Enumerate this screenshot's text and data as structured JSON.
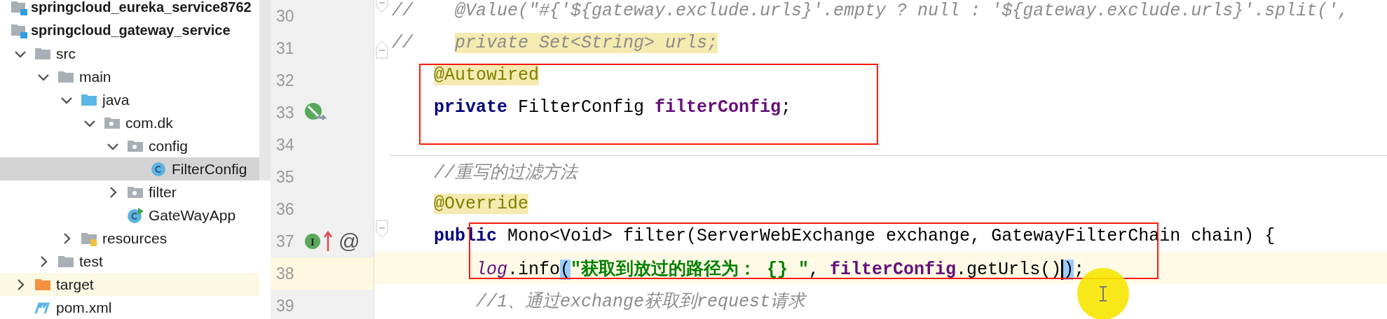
{
  "project_tree": {
    "items": [
      {
        "kind": "module",
        "label": "springcloud_eureka_service8762"
      },
      {
        "kind": "module",
        "label": "springcloud_gateway_service",
        "children": [
          {
            "kind": "folder",
            "label": "src",
            "expanded": true,
            "children": [
              {
                "kind": "folder",
                "label": "main",
                "expanded": true,
                "children": [
                  {
                    "kind": "source-root",
                    "label": "java",
                    "expanded": true,
                    "children": [
                      {
                        "kind": "package",
                        "label": "com.dk",
                        "expanded": true,
                        "children": [
                          {
                            "kind": "package",
                            "label": "config",
                            "expanded": true,
                            "children": [
                              {
                                "kind": "class",
                                "label": "FilterConfig",
                                "selected": true
                              }
                            ]
                          },
                          {
                            "kind": "package",
                            "label": "filter",
                            "expanded": false,
                            "selected": false
                          },
                          {
                            "kind": "app-class",
                            "label": "GateWayApp",
                            "selected": false
                          }
                        ]
                      }
                    ]
                  },
                  {
                    "kind": "resources",
                    "label": "resources",
                    "expanded": false,
                    "selected": false
                  }
                ]
              },
              {
                "kind": "folder",
                "label": "test",
                "expanded": false,
                "selected": false
              }
            ]
          },
          {
            "kind": "excluded",
            "label": "target",
            "expanded": false,
            "selected": false,
            "ignored": true
          },
          {
            "kind": "maven",
            "label": "pom.xml",
            "selected": false
          }
        ]
      }
    ]
  },
  "editor": {
    "lines": [
      {
        "number": "30",
        "kind": "top",
        "fold_start": true,
        "tokens": [
          {
            "kind": "comment",
            "text": "//    @Value(\"#{'${gateway.exclude.urls}'.empty ? null : '${gateway.exclude.urls}'.split(',"
          }
        ]
      },
      {
        "number": "31",
        "kind": "top",
        "fold_end": true,
        "tokens": [
          {
            "kind": "comment",
            "text": "//    "
          },
          {
            "kind": "comment",
            "text": "private Set<String> urls;",
            "marked": true
          }
        ]
      },
      {
        "number": "32",
        "kind": "member",
        "tokens": [
          {
            "kind": "annotation",
            "text": "@Autowired",
            "marked": true
          }
        ]
      },
      {
        "number": "33",
        "kind": "member",
        "gutter": [
          {
            "kind": "bean"
          }
        ],
        "tokens": [
          {
            "kind": "keyword",
            "text": "private"
          },
          {
            "kind": "plain",
            "text": " FilterConfig "
          },
          {
            "kind": "field",
            "text": "filterConfig"
          },
          {
            "kind": "plain",
            "text": ";"
          }
        ]
      },
      {
        "number": "34",
        "kind": "top"
      },
      {
        "number": "35",
        "kind": "member",
        "separator_above": true,
        "tokens": [
          {
            "kind": "comment",
            "text": "//重写的过滤方法"
          }
        ]
      },
      {
        "number": "36",
        "kind": "member",
        "tokens": [
          {
            "kind": "annotation",
            "text": "@Override",
            "marked": true
          }
        ]
      },
      {
        "number": "37",
        "kind": "member",
        "fold_start": true,
        "gutter": [
          {
            "kind": "implements",
            "text": "I"
          },
          {
            "kind": "overrides"
          },
          {
            "kind": "annotation",
            "text": "@"
          }
        ],
        "tokens": [
          {
            "kind": "keyword",
            "text": "public"
          },
          {
            "kind": "plain",
            "text": " Mono<Void> filter(ServerWebExchange exchange, GatewayFilterChain chain) {"
          }
        ]
      },
      {
        "number": "38",
        "kind": "body",
        "current": true,
        "tokens": [
          {
            "kind": "static",
            "text": "log"
          },
          {
            "kind": "plain",
            "text": ".info"
          },
          {
            "kind": "plain",
            "text": "(",
            "matched": true
          },
          {
            "kind": "string",
            "text": "\"获取到放过的路径为： {} \""
          },
          {
            "kind": "plain",
            "text": ", "
          },
          {
            "kind": "field",
            "text": "filterConfig"
          },
          {
            "kind": "plain",
            "text": ".getUrls()"
          },
          {
            "kind": "plain",
            "text": ")",
            "matched": true,
            "caret": true
          },
          {
            "kind": "plain",
            "text": ";"
          }
        ]
      },
      {
        "number": "39",
        "kind": "body",
        "tokens": [
          {
            "kind": "comment",
            "text": "//1、通过exchange获取到request请求"
          }
        ]
      }
    ]
  }
}
